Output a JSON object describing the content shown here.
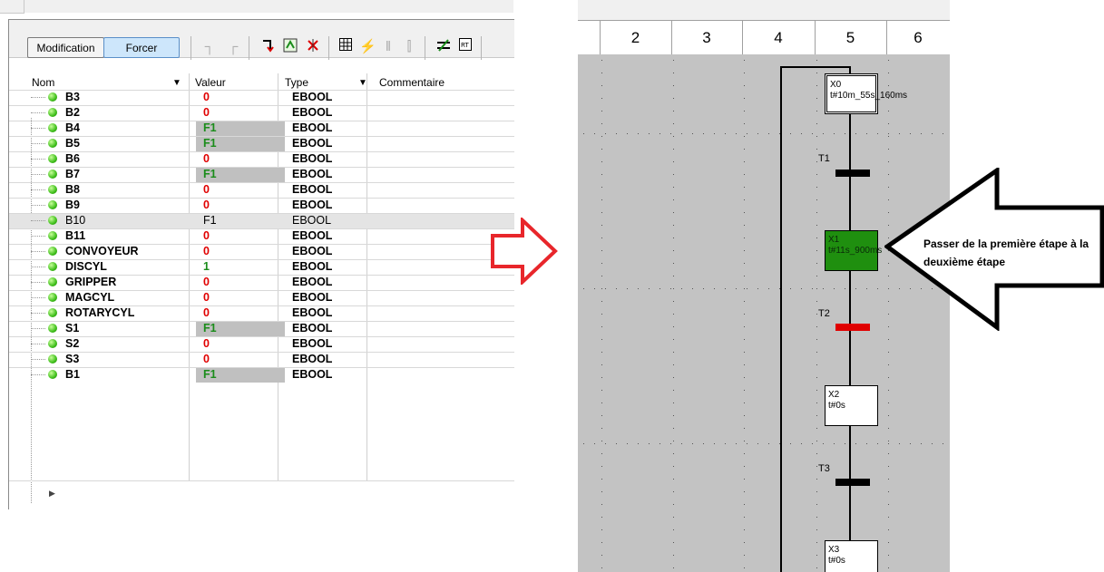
{
  "left_panel": {
    "toolbar": {
      "modification_label": "Modification",
      "forcer_label": "Forcer"
    },
    "columns": {
      "nom": "Nom",
      "valeur": "Valeur",
      "type": "Type",
      "commentaire": "Commentaire"
    },
    "rows": [
      {
        "name": "B3",
        "value": "0",
        "type": "EBOOL",
        "forced": false,
        "value_color": "#e00000"
      },
      {
        "name": "B2",
        "value": "0",
        "type": "EBOOL",
        "forced": false,
        "value_color": "#e00000"
      },
      {
        "name": "B4",
        "value": "F1",
        "type": "EBOOL",
        "forced": true,
        "value_color": "#1a8c1a"
      },
      {
        "name": "B5",
        "value": "F1",
        "type": "EBOOL",
        "forced": true,
        "value_color": "#1a8c1a"
      },
      {
        "name": "B6",
        "value": "0",
        "type": "EBOOL",
        "forced": false,
        "value_color": "#e00000"
      },
      {
        "name": "B7",
        "value": "F1",
        "type": "EBOOL",
        "forced": true,
        "value_color": "#1a8c1a"
      },
      {
        "name": "B8",
        "value": "0",
        "type": "EBOOL",
        "forced": false,
        "value_color": "#e00000"
      },
      {
        "name": "B9",
        "value": "0",
        "type": "EBOOL",
        "forced": false,
        "value_color": "#e00000"
      },
      {
        "name": "B10",
        "value": "F1",
        "type": "EBOOL",
        "forced": false,
        "selected": true,
        "value_color": "#000000"
      },
      {
        "name": "B11",
        "value": "0",
        "type": "EBOOL",
        "forced": false,
        "value_color": "#e00000"
      },
      {
        "name": "CONVOYEUR",
        "value": "0",
        "type": "EBOOL",
        "forced": false,
        "value_color": "#e00000"
      },
      {
        "name": "DISCYL",
        "value": "1",
        "type": "EBOOL",
        "forced": false,
        "value_color": "#1a8c1a"
      },
      {
        "name": "GRIPPER",
        "value": "0",
        "type": "EBOOL",
        "forced": false,
        "value_color": "#e00000"
      },
      {
        "name": "MAGCYL",
        "value": "0",
        "type": "EBOOL",
        "forced": false,
        "value_color": "#e00000"
      },
      {
        "name": "ROTARYCYL",
        "value": "0",
        "type": "EBOOL",
        "forced": false,
        "value_color": "#e00000"
      },
      {
        "name": "S1",
        "value": "F1",
        "type": "EBOOL",
        "forced": true,
        "value_color": "#1a8c1a"
      },
      {
        "name": "S2",
        "value": "0",
        "type": "EBOOL",
        "forced": false,
        "value_color": "#e00000"
      },
      {
        "name": "S3",
        "value": "0",
        "type": "EBOOL",
        "forced": false,
        "value_color": "#e00000"
      },
      {
        "name": "B1",
        "value": "F1",
        "type": "EBOOL",
        "forced": true,
        "value_color": "#1a8c1a"
      }
    ]
  },
  "grafcet": {
    "columns": [
      "2",
      "3",
      "4",
      "5",
      "6"
    ],
    "steps": [
      {
        "name": "X0",
        "time": "t#10m_55s_160ms",
        "state": "initial"
      },
      {
        "name": "X1",
        "time": "t#11s_900ms",
        "state": "active"
      },
      {
        "name": "X2",
        "time": "t#0s",
        "state": "inactive"
      },
      {
        "name": "X3",
        "time": "t#0s",
        "state": "inactive"
      }
    ],
    "transitions": [
      {
        "name": "T1",
        "color": "#000000"
      },
      {
        "name": "T2",
        "color": "#e00000"
      },
      {
        "name": "T3",
        "color": "#000000"
      }
    ]
  },
  "annotation": {
    "text": "Passer de la première étape à la deuxième étape"
  },
  "colors": {
    "active_step": "#1f8f0f",
    "forced_cell": "#c0c0c0",
    "arrow_red": "#e8262b"
  }
}
